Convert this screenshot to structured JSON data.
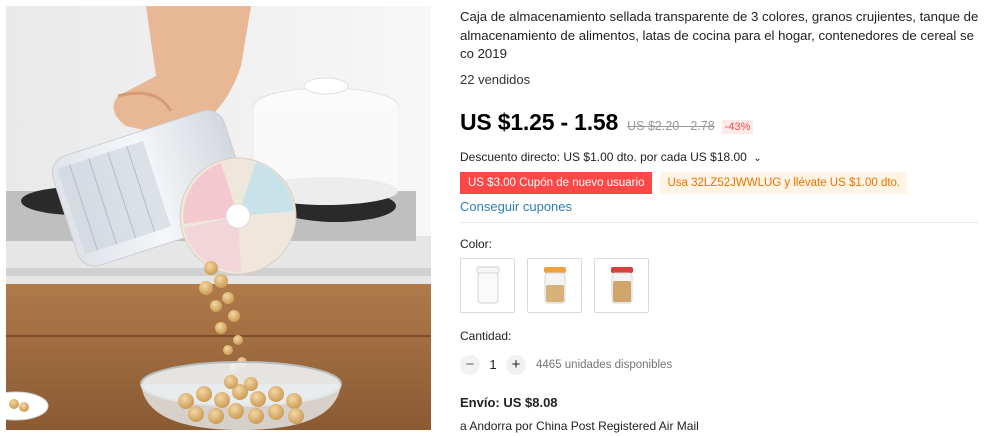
{
  "product": {
    "title": "Caja de almacenamiento sellada transparente de 3 colores, granos crujientes, tanque de almacenamiento de alimentos, latas de cocina para el hogar, contenedores de cereal seco 2019",
    "sold": "22 vendidos",
    "price": "US $1.25 - 1.58",
    "old_price": "US $2.20 - 2.78",
    "discount": "-43%",
    "direct_discount": "Descuento directo: US $1.00 dto. por cada US $18.00",
    "coupon_new_user": "US $3.00 Cupón de nuevo usuario",
    "coupon_code": "Usa 32LZ52JWWLUG y llévate US $1.00 dto.",
    "get_coupons": "Conseguir cupones",
    "color_label": "Color:",
    "colors": [
      "white-lid",
      "orange-lid",
      "red-lid"
    ],
    "quantity_label": "Cantidad:",
    "quantity": "1",
    "stock": "4465 unidades disponibles",
    "shipping": "Envío: US $8.08",
    "shipping_method": "a Andorra por China Post Registered Air Mail"
  },
  "icons": {
    "minus": "−",
    "plus": "+",
    "chevron": "⌄"
  },
  "colors": {
    "price_red": "#ff4747",
    "coupon_orange": "#e87400",
    "link_blue": "#2e7fb8"
  }
}
